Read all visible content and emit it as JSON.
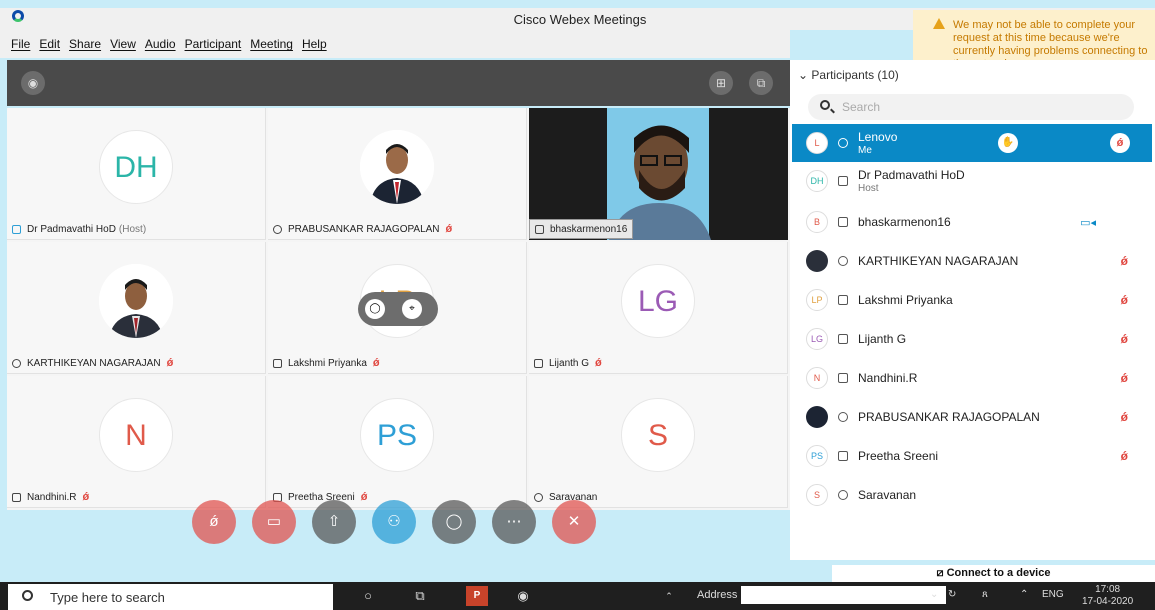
{
  "window": {
    "title": "Cisco Webex Meetings"
  },
  "menu": [
    "File",
    "Edit",
    "Share",
    "View",
    "Audio",
    "Participant",
    "Meeting",
    "Help"
  ],
  "warning": {
    "text": "We may not be able to complete your request at this time because we're currently having problems connecting to the network.",
    "color": "#c57a00"
  },
  "tiles": [
    {
      "initials": "DH",
      "name": "Dr Padmavathi HoD",
      "host_tag": "(Host)",
      "initials_color": "#2bb5a8",
      "kind": "initials",
      "muted": false
    },
    {
      "name": "PRABUSANKAR RAJAGOPALAN",
      "kind": "photo",
      "muted": true
    },
    {
      "name": "bhaskarmenon16",
      "kind": "camera",
      "muted": false
    },
    {
      "name": "KARTHIKEYAN NAGARAJAN",
      "kind": "photo",
      "muted": true
    },
    {
      "initials": "LP",
      "name": "Lakshmi Priyanka",
      "initials_color": "#e0a040",
      "kind": "initials",
      "muted": true
    },
    {
      "initials": "LG",
      "name": "Lijanth G",
      "initials_color": "#9b5bb5",
      "kind": "initials",
      "muted": true
    },
    {
      "initials": "N",
      "name": "Nandhini.R",
      "initials_color": "#e05a4a",
      "kind": "initials",
      "muted": true
    },
    {
      "initials": "PS",
      "name": "Preetha Sreeni",
      "initials_color": "#2e9fd6",
      "kind": "initials",
      "muted": true
    },
    {
      "initials": "S",
      "name": "Saravanan",
      "initials_color": "#e05a4a",
      "kind": "initials",
      "muted": false
    }
  ],
  "participants": {
    "header": "Participants (10)",
    "search_placeholder": "Search",
    "list": [
      {
        "initials": "L",
        "name": "Lenovo",
        "sub": "Me",
        "me": true,
        "muted": true
      },
      {
        "initials": "DH",
        "name": "Dr Padmavathi HoD",
        "sub": "Host",
        "muted": false
      },
      {
        "initials": "B",
        "name": "bhaskarmenon16",
        "muted": false,
        "video": true
      },
      {
        "initials": "",
        "name": "KARTHIKEYAN NAGARAJAN",
        "muted": true,
        "photo": true
      },
      {
        "initials": "LP",
        "name": "Lakshmi Priyanka",
        "muted": true
      },
      {
        "initials": "LG",
        "name": "Lijanth G",
        "muted": true
      },
      {
        "initials": "N",
        "name": "Nandhini.R",
        "muted": true
      },
      {
        "initials": "",
        "name": "PRABUSANKAR RAJAGOPALAN",
        "muted": true,
        "photo": true
      },
      {
        "initials": "PS",
        "name": "Preetha Sreeni",
        "muted": true
      },
      {
        "initials": "S",
        "name": "Saravanan",
        "muted": false
      }
    ]
  },
  "connect_label": "Connect to a device",
  "taskbar": {
    "search_placeholder": "Type here to search",
    "address_label": "Address",
    "lang": "ENG",
    "time": "17:08",
    "date": "17-04-2020"
  }
}
